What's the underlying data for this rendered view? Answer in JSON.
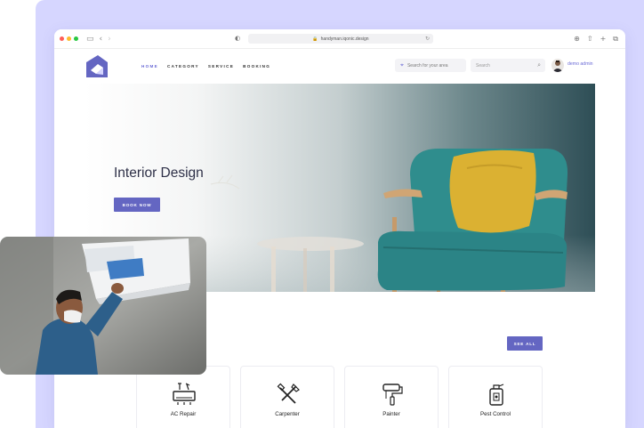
{
  "browser": {
    "url": "handyman.iqonic.design",
    "traffic_lights": [
      "#ff5f57",
      "#febc2e",
      "#28c840"
    ]
  },
  "nav": {
    "menu": [
      {
        "label": "HOME",
        "active": true
      },
      {
        "label": "CATEGORY",
        "active": false
      },
      {
        "label": "SERVICE",
        "active": false
      },
      {
        "label": "BOOKING",
        "active": false
      }
    ],
    "location_placeholder": "Search for your area",
    "search_placeholder": "Search",
    "user_name": "demo admin"
  },
  "hero": {
    "title": "Interior Design",
    "button_label": "BOOK NOW"
  },
  "categories": {
    "see_all_label": "SEE ALL",
    "items": [
      {
        "label": "AC Repair",
        "icon": "ac-repair-icon"
      },
      {
        "label": "Carpenter",
        "icon": "carpenter-icon"
      },
      {
        "label": "Painter",
        "icon": "painter-icon"
      },
      {
        "label": "Pest Control",
        "icon": "pest-control-icon"
      }
    ]
  },
  "colors": {
    "accent": "#6466c2",
    "background": "#d6d6ff"
  }
}
